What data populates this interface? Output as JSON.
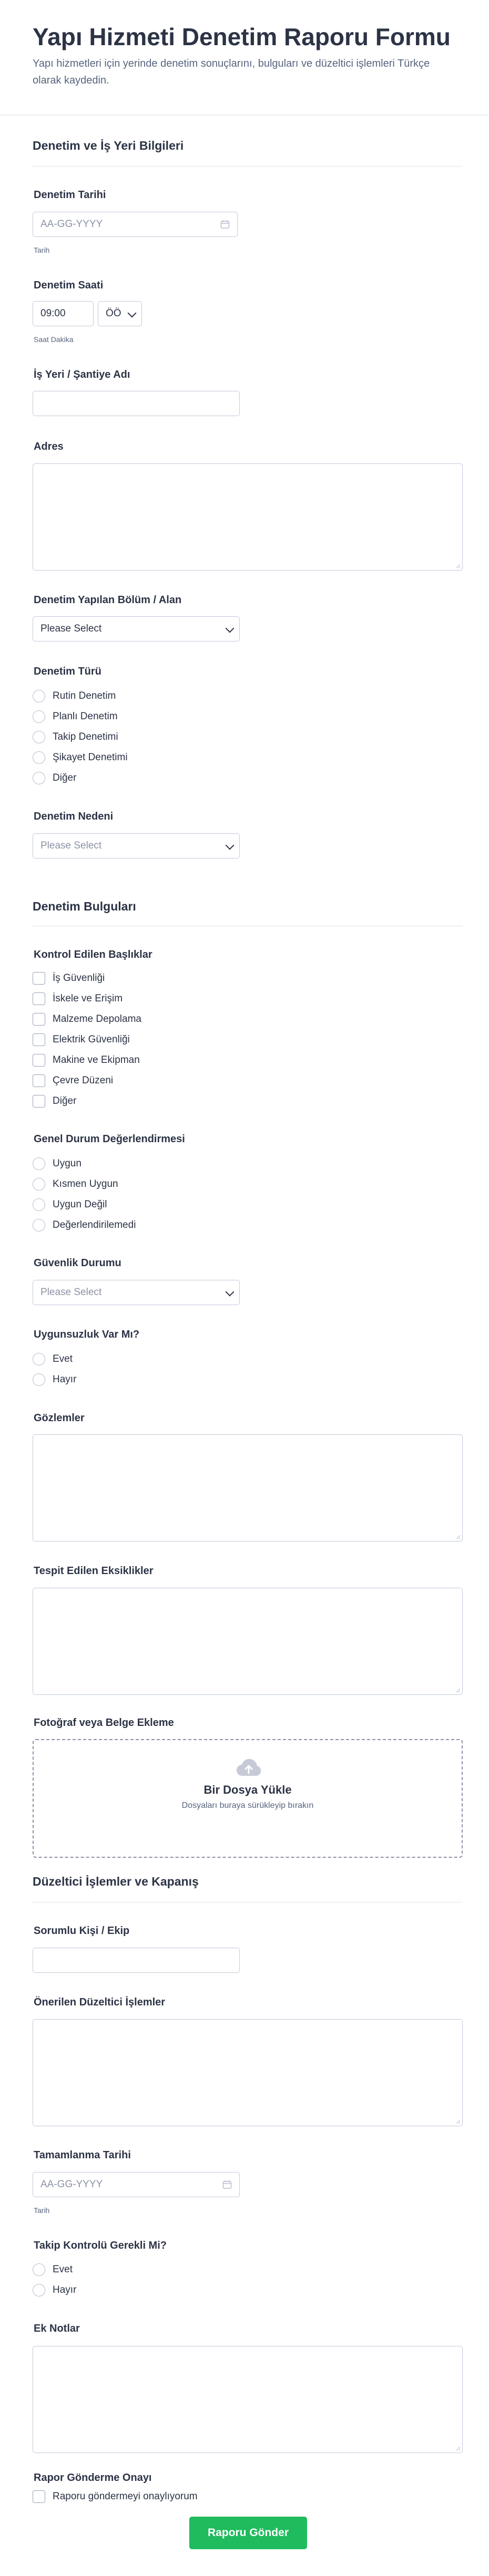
{
  "form": {
    "title": "Yapı Hizmeti Denetim Raporu Formu",
    "description": "Yapı hizmetleri için yerinde denetim sonuçlarını, bulguları ve düzeltici işlemleri Türkçe olarak kaydedin."
  },
  "section1": {
    "title": "Denetim ve İş Yeri Bilgileri",
    "date": {
      "label": "Denetim Tarihi",
      "placeholder": "AA-GG-YYYY",
      "sublabel": "Tarih"
    },
    "time": {
      "label": "Denetim Saati",
      "value": "09:00",
      "ampm": "ÖÖ",
      "sublabel": "Saat Dakika"
    },
    "site": {
      "label": "İş Yeri / Şantiye Adı",
      "value": ""
    },
    "address": {
      "label": "Adres"
    },
    "area": {
      "label": "Denetim Yapılan Bölüm / Alan",
      "selected": "Please Select"
    },
    "type": {
      "label": "Denetim Türü",
      "options": [
        "Rutin Denetim",
        "Planlı Denetim",
        "Takip Denetimi",
        "Şikayet Denetimi",
        "Diğer"
      ]
    },
    "reason": {
      "label": "Denetim Nedeni",
      "selected": "Please Select"
    }
  },
  "section2": {
    "title": "Denetim Bulguları",
    "checks": {
      "label": "Kontrol Edilen Başlıklar",
      "options": [
        "İş Güvenliği",
        "İskele ve Erişim",
        "Malzeme Depolama",
        "Elektrik Güvenliği",
        "Makine ve Ekipman",
        "Çevre Düzeni",
        "Diğer"
      ]
    },
    "overall": {
      "label": "Genel Durum Değerlendirmesi",
      "options": [
        "Uygun",
        "Kısmen Uygun",
        "Uygun Değil",
        "Değerlendirilemedi"
      ]
    },
    "safety": {
      "label": "Güvenlik Durumu",
      "selected": "Please Select"
    },
    "nonconf": {
      "label": "Uygunsuzluk Var Mı?",
      "options": [
        "Evet",
        "Hayır"
      ]
    },
    "observations": {
      "label": "Gözlemler"
    },
    "deficiencies": {
      "label": "Tespit Edilen Eksiklikler"
    },
    "upload": {
      "label": "Fotoğraf veya Belge Ekleme",
      "title": "Bir Dosya Yükle",
      "hint": "Dosyaları buraya sürükleyip bırakın"
    }
  },
  "section3": {
    "title": "Düzeltici İşlemler ve Kapanış",
    "responsible": {
      "label": "Sorumlu Kişi / Ekip",
      "value": ""
    },
    "actions": {
      "label": "Önerilen Düzeltici İşlemler"
    },
    "completion": {
      "label": "Tamamlanma Tarihi",
      "placeholder": "AA-GG-YYYY",
      "sublabel": "Tarih"
    },
    "followup": {
      "label": "Takip Kontrolü Gerekli Mi?",
      "options": [
        "Evet",
        "Hayır"
      ]
    },
    "notes": {
      "label": "Ek Notlar"
    },
    "confirm": {
      "label": "Rapor Gönderme Onayı",
      "option": "Raporu göndermeyi onaylıyorum"
    }
  },
  "submit": {
    "label": "Raporu Gönder"
  },
  "icons": {
    "calendar": "calendar-icon",
    "chevron": "chevron-down-icon",
    "upload": "cloud-upload-icon",
    "resize": "resize-grip-icon"
  },
  "colors": {
    "submit": "#1fbb5d",
    "text": "#2c3345",
    "muted": "#57647e",
    "border": "#c3cad8"
  }
}
